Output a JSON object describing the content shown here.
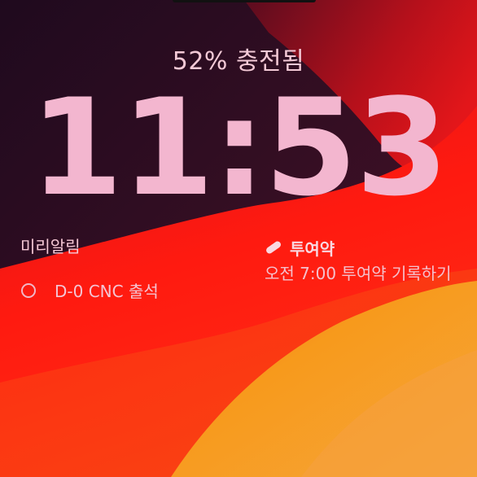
{
  "status": {
    "charge_text": "52% 충전됨"
  },
  "clock": {
    "time": "11:53"
  },
  "reminders_widget": {
    "title": "미리알림",
    "items": [
      {
        "label": "D-0 CNC 출석"
      }
    ]
  },
  "medication_widget": {
    "title": "투여약",
    "body": "오전 7:00 투여약 기록하기",
    "icon": "pill-icon"
  },
  "colors": {
    "text_pink": "#f3b6cf",
    "dark_bg": "#2a0f24",
    "red": "#ff1a12",
    "orange": "#f7941d"
  }
}
